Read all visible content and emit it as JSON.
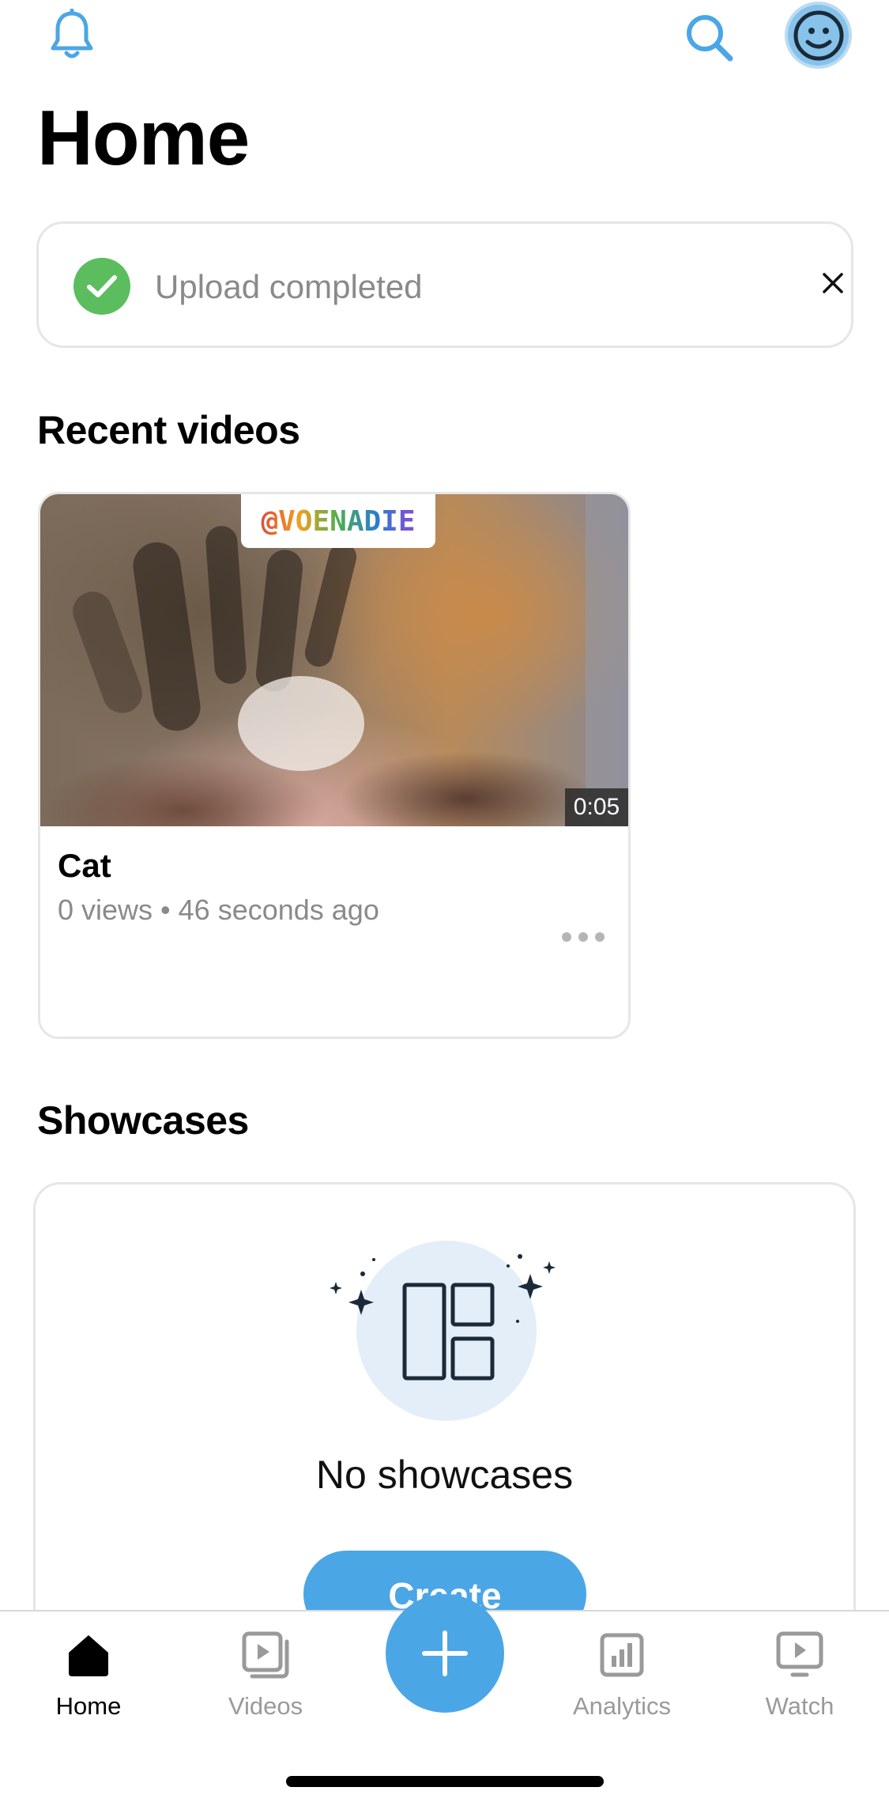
{
  "header": {
    "title": "Home",
    "icons": {
      "notifications": "bell-icon",
      "search": "search-icon",
      "profile": "avatar-face-icon"
    }
  },
  "banner": {
    "message": "Upload completed",
    "status_color": "#5cbd5f",
    "icons": {
      "status": "check-icon",
      "dismiss": "close-icon"
    }
  },
  "recent_videos": {
    "title": "Recent videos",
    "items": [
      {
        "thumbnail_watermark": "@VOENADIE",
        "duration": "0:05",
        "name": "Cat",
        "meta": "0 views • 46 seconds ago",
        "more_icon": "more-dots-icon"
      }
    ]
  },
  "showcases": {
    "title": "Showcases",
    "empty_text": "No showcases",
    "create_label": "Create",
    "illustration_icon": "layout-grid-sparkle-icon"
  },
  "bottom_nav": {
    "items": [
      {
        "label": "Home",
        "icon": "home-icon",
        "active": true
      },
      {
        "label": "Videos",
        "icon": "videos-icon",
        "active": false
      },
      {
        "label": "Analytics",
        "icon": "analytics-icon",
        "active": false
      },
      {
        "label": "Watch",
        "icon": "watch-icon",
        "active": false
      }
    ],
    "fab_icon": "plus-icon"
  },
  "colors": {
    "accent": "#4ba6e6",
    "success": "#5cbd5f",
    "muted_text": "#8a8a8a"
  }
}
